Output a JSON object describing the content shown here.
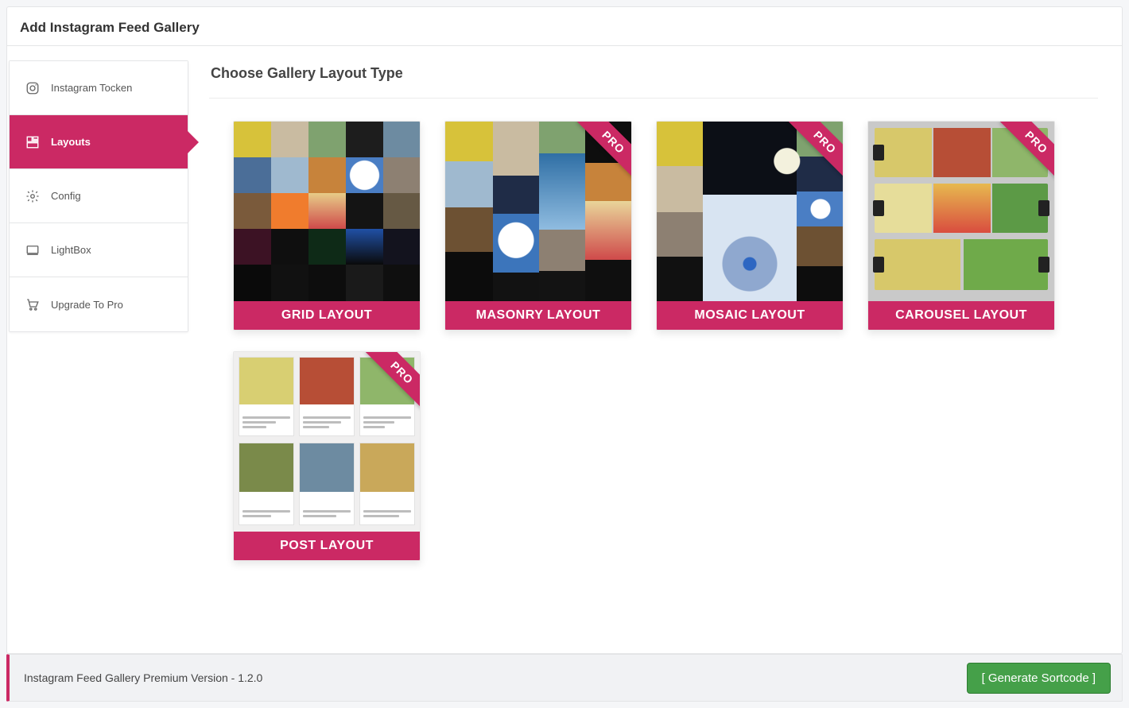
{
  "header": {
    "title": "Add Instagram Feed Gallery"
  },
  "sidebar": {
    "items": [
      {
        "label": "Instagram Tocken",
        "icon": "instagram-icon",
        "active": false
      },
      {
        "label": "Layouts",
        "icon": "layouts-icon",
        "active": true
      },
      {
        "label": "Config",
        "icon": "gear-icon",
        "active": false
      },
      {
        "label": "LightBox",
        "icon": "lightbox-icon",
        "active": false
      },
      {
        "label": "Upgrade To Pro",
        "icon": "cart-icon",
        "active": false
      }
    ]
  },
  "content": {
    "section_title": "Choose Gallery Layout Type",
    "pro_badge": "PRO",
    "layouts": [
      {
        "name": "GRID LAYOUT",
        "pro": false,
        "thumb": "grid"
      },
      {
        "name": "MASONRY LAYOUT",
        "pro": true,
        "thumb": "masonry"
      },
      {
        "name": "MOSAIC LAYOUT",
        "pro": true,
        "thumb": "mosaic"
      },
      {
        "name": "CAROUSEL LAYOUT",
        "pro": true,
        "thumb": "carousel"
      },
      {
        "name": "POST  LAYOUT",
        "pro": true,
        "thumb": "post"
      }
    ]
  },
  "footer": {
    "text": "Instagram Feed Gallery Premium Version - 1.2.0",
    "button": "[ Generate Sortcode ]"
  },
  "colors": {
    "accent": "#cb2964",
    "green": "#45a049"
  }
}
